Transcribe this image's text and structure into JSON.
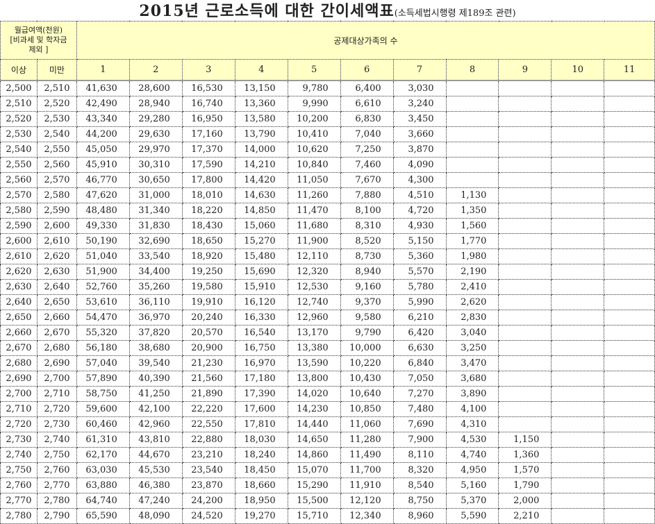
{
  "title": {
    "main": "2015년 근로소득에 대한 간이세액표",
    "sub": "(소득세법시행령 제189조 관련)"
  },
  "header": {
    "income_label_line1": "월급여액(천원)",
    "income_label_line2": "[비과세 및 학자금",
    "income_label_line3": "제외 ]",
    "dependents_label": "공제대상가족의 수",
    "col_min": "이상",
    "col_max": "미만",
    "family_counts": [
      "1",
      "2",
      "3",
      "4",
      "5",
      "6",
      "7",
      "8",
      "9",
      "10",
      "11"
    ]
  },
  "rows": [
    [
      "2,500",
      "2,510",
      "41,630",
      "28,600",
      "16,530",
      "13,150",
      "9,780",
      "6,400",
      "3,030",
      "",
      "",
      "",
      ""
    ],
    [
      "2,510",
      "2,520",
      "42,490",
      "28,940",
      "16,740",
      "13,360",
      "9,990",
      "6,610",
      "3,240",
      "",
      "",
      "",
      ""
    ],
    [
      "2,520",
      "2,530",
      "43,340",
      "29,280",
      "16,950",
      "13,580",
      "10,200",
      "6,830",
      "3,450",
      "",
      "",
      "",
      ""
    ],
    [
      "2,530",
      "2,540",
      "44,200",
      "29,630",
      "17,160",
      "13,790",
      "10,410",
      "7,040",
      "3,660",
      "",
      "",
      "",
      ""
    ],
    [
      "2,540",
      "2,550",
      "45,050",
      "29,970",
      "17,370",
      "14,000",
      "10,620",
      "7,250",
      "3,870",
      "",
      "",
      "",
      ""
    ],
    [
      "2,550",
      "2,560",
      "45,910",
      "30,310",
      "17,590",
      "14,210",
      "10,840",
      "7,460",
      "4,090",
      "",
      "",
      "",
      ""
    ],
    [
      "2,560",
      "2,570",
      "46,770",
      "30,650",
      "17,800",
      "14,420",
      "11,050",
      "7,670",
      "4,300",
      "",
      "",
      "",
      ""
    ],
    [
      "2,570",
      "2,580",
      "47,620",
      "31,000",
      "18,010",
      "14,630",
      "11,260",
      "7,880",
      "4,510",
      "1,130",
      "",
      "",
      ""
    ],
    [
      "2,580",
      "2,590",
      "48,480",
      "31,340",
      "18,220",
      "14,850",
      "11,470",
      "8,100",
      "4,720",
      "1,350",
      "",
      "",
      ""
    ],
    [
      "2,590",
      "2,600",
      "49,330",
      "31,830",
      "18,430",
      "15,060",
      "11,680",
      "8,310",
      "4,930",
      "1,560",
      "",
      "",
      ""
    ],
    [
      "2,600",
      "2,610",
      "50,190",
      "32,690",
      "18,650",
      "15,270",
      "11,900",
      "8,520",
      "5,150",
      "1,770",
      "",
      "",
      ""
    ],
    [
      "2,610",
      "2,620",
      "51,040",
      "33,540",
      "18,920",
      "15,480",
      "12,110",
      "8,730",
      "5,360",
      "1,980",
      "",
      "",
      ""
    ],
    [
      "2,620",
      "2,630",
      "51,900",
      "34,400",
      "19,250",
      "15,690",
      "12,320",
      "8,940",
      "5,570",
      "2,190",
      "",
      "",
      ""
    ],
    [
      "2,630",
      "2,640",
      "52,760",
      "35,260",
      "19,580",
      "15,910",
      "12,530",
      "9,160",
      "5,780",
      "2,410",
      "",
      "",
      ""
    ],
    [
      "2,640",
      "2,650",
      "53,610",
      "36,110",
      "19,910",
      "16,120",
      "12,740",
      "9,370",
      "5,990",
      "2,620",
      "",
      "",
      ""
    ],
    [
      "2,650",
      "2,660",
      "54,470",
      "36,970",
      "20,240",
      "16,330",
      "12,960",
      "9,580",
      "6,210",
      "2,830",
      "",
      "",
      ""
    ],
    [
      "2,660",
      "2,670",
      "55,320",
      "37,820",
      "20,570",
      "16,540",
      "13,170",
      "9,790",
      "6,420",
      "3,040",
      "",
      "",
      ""
    ],
    [
      "2,670",
      "2,680",
      "56,180",
      "38,680",
      "20,900",
      "16,750",
      "13,380",
      "10,000",
      "6,630",
      "3,250",
      "",
      "",
      ""
    ],
    [
      "2,680",
      "2,690",
      "57,040",
      "39,540",
      "21,230",
      "16,970",
      "13,590",
      "10,220",
      "6,840",
      "3,470",
      "",
      "",
      ""
    ],
    [
      "2,690",
      "2,700",
      "57,890",
      "40,390",
      "21,560",
      "17,180",
      "13,800",
      "10,430",
      "7,050",
      "3,680",
      "",
      "",
      ""
    ],
    [
      "2,700",
      "2,710",
      "58,750",
      "41,250",
      "21,890",
      "17,390",
      "14,020",
      "10,640",
      "7,270",
      "3,890",
      "",
      "",
      ""
    ],
    [
      "2,710",
      "2,720",
      "59,600",
      "42,100",
      "22,220",
      "17,600",
      "14,230",
      "10,850",
      "7,480",
      "4,100",
      "",
      "",
      ""
    ],
    [
      "2,720",
      "2,730",
      "60,460",
      "42,960",
      "22,550",
      "17,810",
      "14,440",
      "11,060",
      "7,690",
      "4,310",
      "",
      "",
      ""
    ],
    [
      "2,730",
      "2,740",
      "61,310",
      "43,810",
      "22,880",
      "18,030",
      "14,650",
      "11,280",
      "7,900",
      "4,530",
      "1,150",
      "",
      ""
    ],
    [
      "2,740",
      "2,750",
      "62,170",
      "44,670",
      "23,210",
      "18,240",
      "14,860",
      "11,490",
      "8,110",
      "4,740",
      "1,360",
      "",
      ""
    ],
    [
      "2,750",
      "2,760",
      "63,030",
      "45,530",
      "23,540",
      "18,450",
      "15,070",
      "11,700",
      "8,320",
      "4,950",
      "1,570",
      "",
      ""
    ],
    [
      "2,760",
      "2,770",
      "63,880",
      "46,380",
      "23,870",
      "18,660",
      "15,290",
      "11,910",
      "8,540",
      "5,160",
      "1,790",
      "",
      ""
    ],
    [
      "2,770",
      "2,780",
      "64,740",
      "47,240",
      "24,200",
      "18,950",
      "15,500",
      "12,120",
      "8,750",
      "5,370",
      "2,000",
      "",
      ""
    ],
    [
      "2,780",
      "2,790",
      "65,590",
      "48,090",
      "24,520",
      "19,270",
      "15,710",
      "12,340",
      "8,960",
      "5,590",
      "2,210",
      "",
      ""
    ]
  ]
}
